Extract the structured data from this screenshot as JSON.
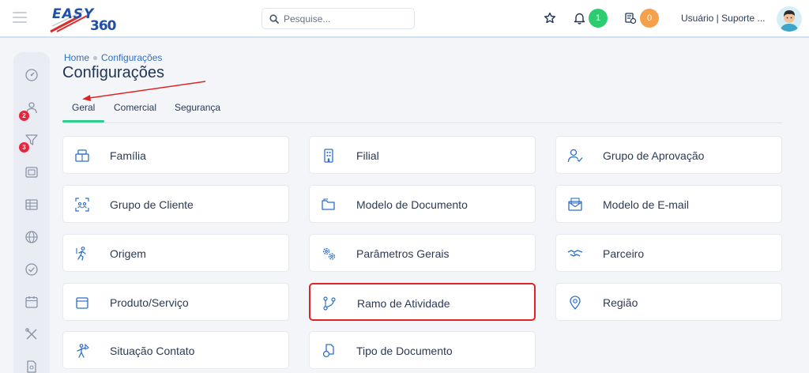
{
  "header": {
    "logo_word": "EASY",
    "logo_num": "360",
    "search_placeholder": "Pesquise...",
    "notifications_count": "1",
    "tasks_count": "0",
    "user_label": "Usuário | Suporte ...",
    "colors": {
      "green_badge": "#2ecc71",
      "orange_badge": "#f5a04a",
      "accent": "#2f6fc7"
    }
  },
  "sidebar": {
    "icons": [
      "dashboard-icon",
      "users-icon",
      "filter-icon",
      "image-icon",
      "table-icon",
      "globe-icon",
      "check-circle-icon",
      "calendar-icon",
      "tools-icon",
      "document-icon"
    ],
    "badges": {
      "users": "2",
      "filter": "3"
    }
  },
  "breadcrumb": {
    "home": "Home",
    "current": "Configurações"
  },
  "page": {
    "title": "Configurações"
  },
  "tabs": [
    {
      "label": "Geral",
      "active": true
    },
    {
      "label": "Comercial",
      "active": false
    },
    {
      "label": "Segurança",
      "active": false
    }
  ],
  "cards": [
    {
      "label": "Família",
      "icon": "boxes-icon"
    },
    {
      "label": "Filial",
      "icon": "building-icon"
    },
    {
      "label": "Grupo de Aprovação",
      "icon": "user-check-icon"
    },
    {
      "label": "Grupo de Cliente",
      "icon": "customer-group-icon"
    },
    {
      "label": "Modelo de Documento",
      "icon": "folder-icon"
    },
    {
      "label": "Modelo de E-mail",
      "icon": "mail-template-icon"
    },
    {
      "label": "Origem",
      "icon": "origin-icon"
    },
    {
      "label": "Parâmetros Gerais",
      "icon": "gears-icon"
    },
    {
      "label": "Parceiro",
      "icon": "handshake-icon"
    },
    {
      "label": "Produto/Serviço",
      "icon": "package-icon"
    },
    {
      "label": "Ramo de Atividade",
      "icon": "branch-icon"
    },
    {
      "label": "Região",
      "icon": "map-pin-icon"
    },
    {
      "label": "Situação Contato",
      "icon": "contact-status-icon"
    },
    {
      "label": "Tipo de Documento",
      "icon": "document-type-icon"
    }
  ]
}
